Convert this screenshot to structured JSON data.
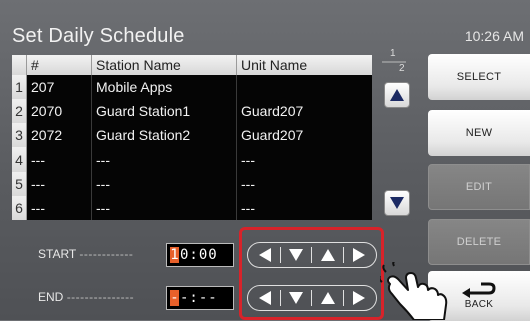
{
  "header": {
    "title": "Set Daily Schedule",
    "clock": "10:26 AM"
  },
  "table": {
    "columns": [
      "#",
      "Station Name",
      "Unit Name"
    ],
    "rows": [
      {
        "index": "1",
        "number": "207",
        "station": "Mobile Apps",
        "unit": ""
      },
      {
        "index": "2",
        "number": "2070",
        "station": "Guard Station1",
        "unit": "Guard207"
      },
      {
        "index": "3",
        "number": "2072",
        "station": "Guard Station2",
        "unit": "Guard207"
      },
      {
        "index": "4",
        "number": "---",
        "station": "---",
        "unit": "---"
      },
      {
        "index": "5",
        "number": "---",
        "station": "---",
        "unit": "---"
      },
      {
        "index": "6",
        "number": "---",
        "station": "---",
        "unit": "---"
      }
    ]
  },
  "pager": {
    "current": "1",
    "total": "2"
  },
  "side_buttons": {
    "select": "SELECT",
    "new": "NEW",
    "edit": "EDIT",
    "delete": "DELETE",
    "back": "BACK"
  },
  "schedule": {
    "start_label": "START",
    "start_dashes": "------------",
    "start_cursor": "1",
    "start_rest": "0:00",
    "end_label": "END",
    "end_dashes": "---------------",
    "end_cursor": "-",
    "end_rest": "-:--"
  },
  "icons": {
    "scroll_up": "triangle-up-icon",
    "scroll_down": "triangle-down-icon",
    "left": "left-arrow-icon",
    "down": "down-arrow-icon",
    "up": "up-arrow-icon",
    "right": "right-arrow-icon",
    "back": "return-arrow-icon",
    "hand": "tap-hand-icon"
  },
  "colors": {
    "cursor": "#e8602a",
    "highlight": "#d8232a"
  }
}
